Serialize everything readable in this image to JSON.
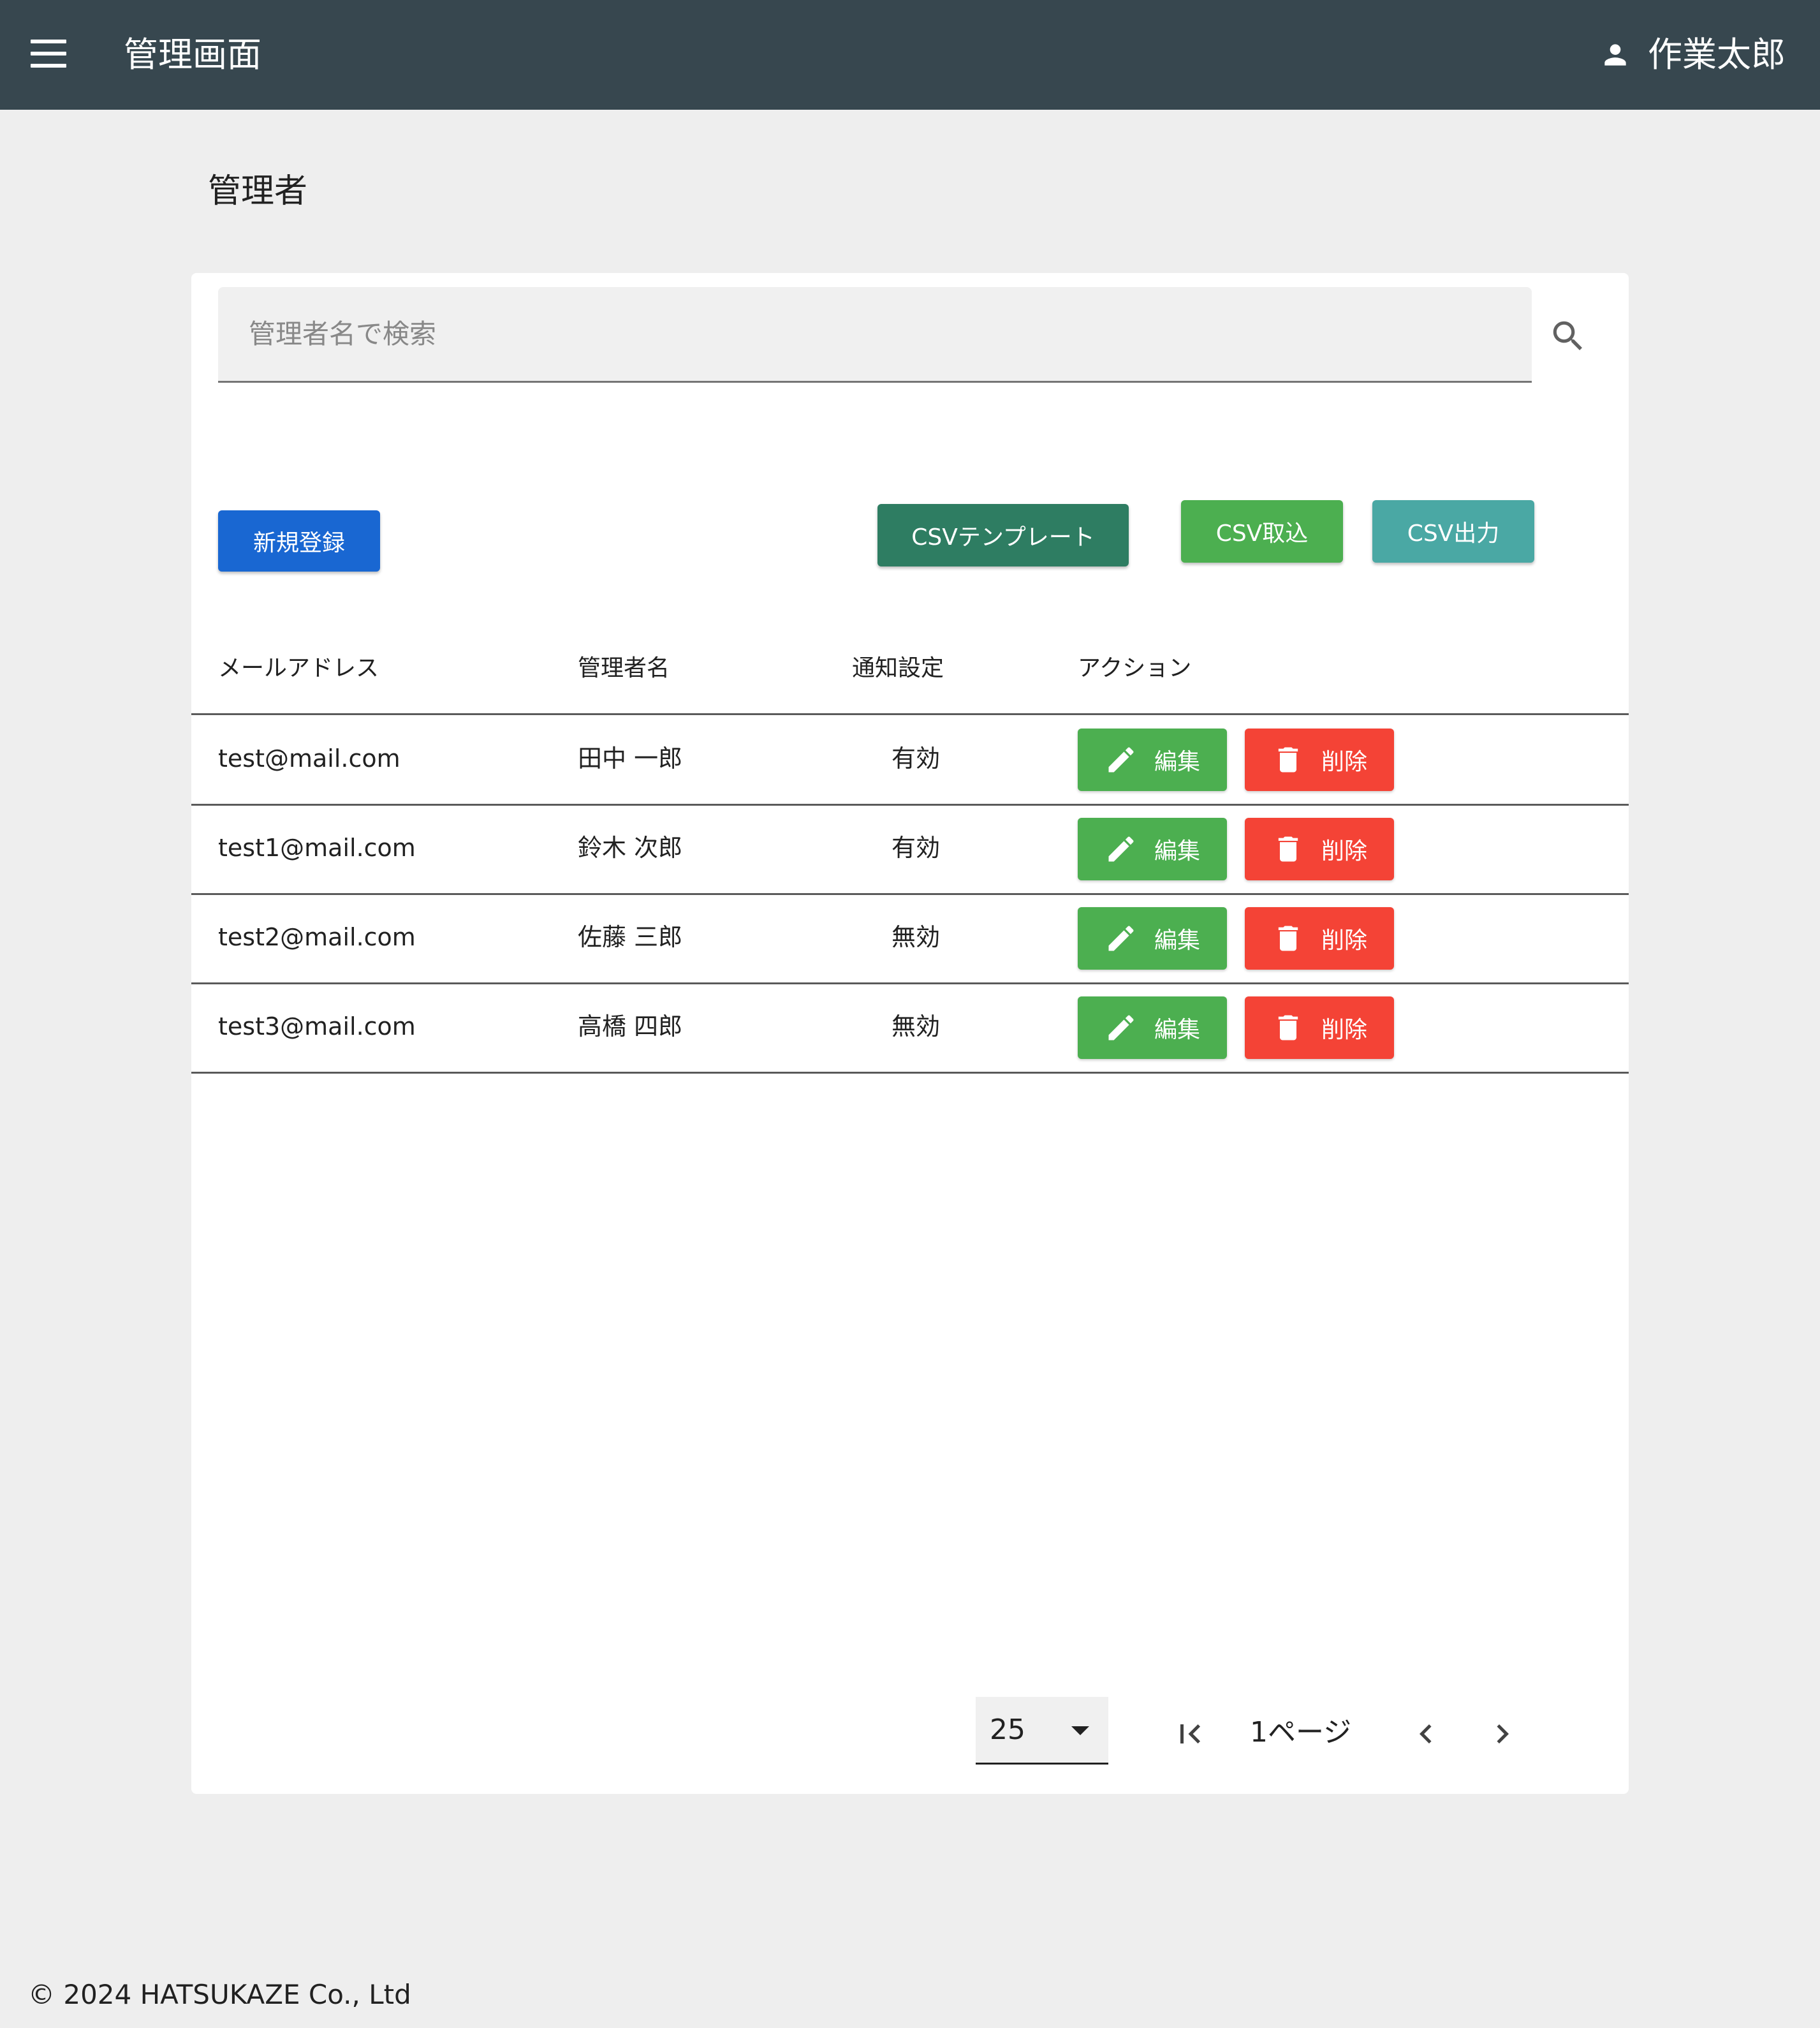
{
  "appbar": {
    "title": "管理画面",
    "user_name": "作業太郎"
  },
  "page": {
    "title": "管理者"
  },
  "search": {
    "placeholder": "管理者名で検索"
  },
  "toolbar": {
    "new_label": "新規登録",
    "csv_template_label": "CSVテンプレート",
    "csv_import_label": "CSV取込",
    "csv_export_label": "CSV出力"
  },
  "table": {
    "headers": {
      "email": "メールアドレス",
      "name": "管理者名",
      "notify": "通知設定",
      "action": "アクション"
    },
    "rows": [
      {
        "email": "test@mail.com",
        "name": "田中 一郎",
        "notify": "有効"
      },
      {
        "email": "test1@mail.com",
        "name": "鈴木 次郎",
        "notify": "有効"
      },
      {
        "email": "test2@mail.com",
        "name": "佐藤 三郎",
        "notify": "無効"
      },
      {
        "email": "test3@mail.com",
        "name": "高橋 四郎",
        "notify": "無効"
      }
    ],
    "edit_label": "編集",
    "delete_label": "削除"
  },
  "pagination": {
    "rows_per_page": "25",
    "page_label": "1ページ"
  },
  "footer": {
    "copyright": "© 2024 HATSUKAZE Co., Ltd"
  },
  "colors": {
    "appbar": "#37474f",
    "primary": "#1967d2",
    "csv_template": "#2e7d62",
    "success": "#4caf50",
    "teal": "#4aa8a4",
    "danger": "#f44336"
  },
  "icons": [
    "menu-icon",
    "user-icon",
    "search-icon",
    "pencil-icon",
    "trash-icon",
    "first-page-icon",
    "chevron-left-icon",
    "chevron-right-icon",
    "dropdown-caret-icon"
  ]
}
